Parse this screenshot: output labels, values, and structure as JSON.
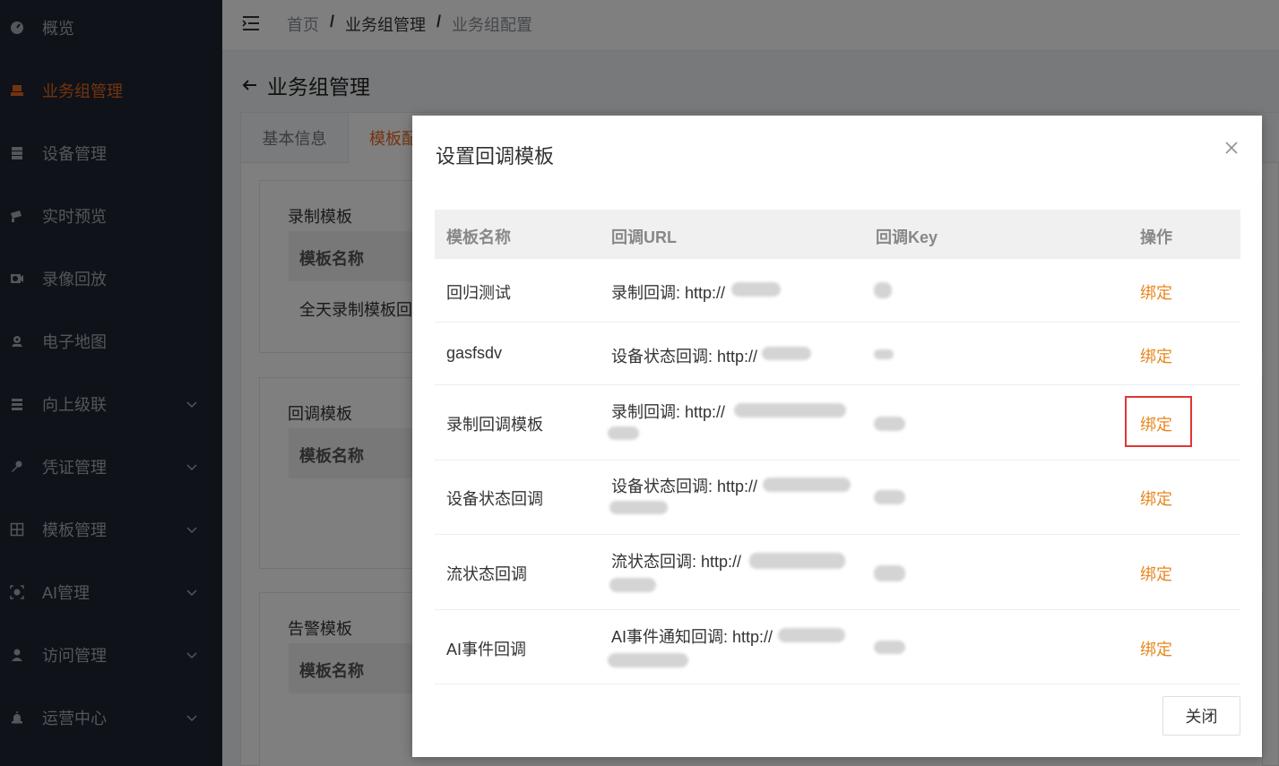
{
  "sidebar": {
    "items": [
      {
        "label": "概览",
        "icon": "dashboard-icon",
        "active": false,
        "expandable": false
      },
      {
        "label": "业务组管理",
        "icon": "group-icon",
        "active": true,
        "expandable": false
      },
      {
        "label": "设备管理",
        "icon": "device-icon",
        "active": false,
        "expandable": false
      },
      {
        "label": "实时预览",
        "icon": "camera-icon",
        "active": false,
        "expandable": false
      },
      {
        "label": "录像回放",
        "icon": "playback-icon",
        "active": false,
        "expandable": false
      },
      {
        "label": "电子地图",
        "icon": "map-icon",
        "active": false,
        "expandable": false
      },
      {
        "label": "向上级联",
        "icon": "cascade-icon",
        "active": false,
        "expandable": true
      },
      {
        "label": "凭证管理",
        "icon": "key-icon",
        "active": false,
        "expandable": true
      },
      {
        "label": "模板管理",
        "icon": "grid-icon",
        "active": false,
        "expandable": true
      },
      {
        "label": "AI管理",
        "icon": "ai-icon",
        "active": false,
        "expandable": true
      },
      {
        "label": "访问管理",
        "icon": "user-icon",
        "active": false,
        "expandable": true
      },
      {
        "label": "运营中心",
        "icon": "alarm-icon",
        "active": false,
        "expandable": true
      }
    ]
  },
  "breadcrumb": {
    "home": "首页",
    "level2": "业务组管理",
    "current": "业务组配置",
    "separator": "/"
  },
  "page": {
    "title": "业务组管理",
    "tabs": [
      "基本信息",
      "模板配"
    ],
    "sections": {
      "record": {
        "title": "录制模板",
        "header": "模板名称",
        "row": "全天录制模板回调"
      },
      "callback": {
        "title": "回调模板",
        "header": "模板名称"
      },
      "alarm": {
        "title": "告警模板",
        "header": "模板名称"
      }
    }
  },
  "dialog": {
    "title": "设置回调模板",
    "columns": [
      "模板名称",
      "回调URL",
      "回调Key",
      "操作"
    ],
    "rows": [
      {
        "name": "回归测试",
        "url": "录制回调: http://",
        "action": "绑定"
      },
      {
        "name": "gasfsdv",
        "url": "设备状态回调: http://",
        "action": "绑定"
      },
      {
        "name": "录制回调模板",
        "url": "录制回调: http://",
        "action": "绑定"
      },
      {
        "name": "设备状态回调",
        "url": "设备状态回调: http://",
        "action": "绑定"
      },
      {
        "name": "流状态回调",
        "url": "流状态回调: http://",
        "action": "绑定"
      },
      {
        "name": "AI事件回调",
        "url": "AI事件通知回调: http://",
        "action": "绑定"
      }
    ],
    "close_label": "关闭"
  },
  "colors": {
    "accent": "#e8661e",
    "link": "#e8861e",
    "sidebar_bg": "#1e2530",
    "highlight": "#e03636"
  }
}
